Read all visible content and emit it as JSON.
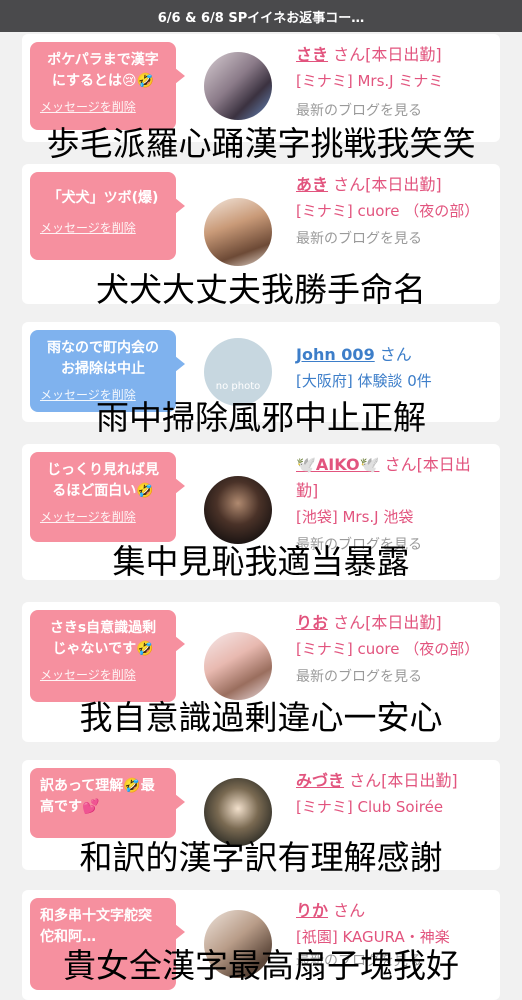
{
  "header": {
    "title": "6/6 & 6/8 SPイイネお返事コー…"
  },
  "cards": [
    {
      "bubble": "ポケパラまで漢字\nにするとは😢🤣",
      "delete_label": "メッセージを削除",
      "name": "さき",
      "suffix": "さん[本日出勤]",
      "shop": "[ミナミ] Mrs.J ミナミ",
      "blog": "最新のブログを見る",
      "overlay": "歩毛派羅心踊漢字挑戦我笑笑"
    },
    {
      "bubble": "「犬犬」ツボ(爆)",
      "delete_label": "メッセージを削除",
      "name": "あき",
      "suffix": "さん[本日出勤]",
      "shop": "[ミナミ] cuore （夜の部）",
      "blog": "最新のブログを見る",
      "overlay": "犬犬大丈夫我勝手命名"
    },
    {
      "bubble": "雨なので町内会の\nお掃除は中止",
      "delete_label": "メッセージを削除",
      "name": "John 009",
      "suffix": "さん",
      "shop": "[大阪府] 体験談 0件",
      "avatar_text": "no photo",
      "overlay": "雨中掃除風邪中止正解"
    },
    {
      "bubble": "じっくり見れば見\nるほど面白い🤣",
      "delete_label": "メッセージを削除",
      "name": "🕊️AIKO🕊️",
      "suffix": "さん[本日出勤]",
      "shop": "[池袋] Mrs.J 池袋",
      "blog": "最新のブログを見る",
      "overlay": "集中見恥我適当暴露"
    },
    {
      "bubble": "さきs自意識過剰\nじゃないです🤣",
      "delete_label": "メッセージを削除",
      "name": "りお",
      "suffix": "さん[本日出勤]",
      "shop": "[ミナミ] cuore （夜の部）",
      "blog": "最新のブログを見る",
      "overlay": "我自意識過剰違心一安心"
    },
    {
      "bubble": "訳あって理解🤣最\n高です💕",
      "delete_label": "メッセージを削除",
      "name": "みづき",
      "suffix": "さん[本日出勤]",
      "shop": "[ミナミ] Club Soirée",
      "blog": "最新のブログを見る",
      "overlay": "和訳的漢字訳有理解感謝"
    },
    {
      "bubble": "和多串十文字舵突\n佗和阿…",
      "delete_label": "メッセージを削除",
      "name": "りか",
      "suffix": "さん",
      "shop": "[祇園] KAGURA・神楽",
      "blog": "最新のブログを見る",
      "overlay": "貴女全漢字最高扇子塊我好"
    }
  ],
  "colors": {
    "accent_pink": "#e2547e",
    "bubble_pink": "#f6909f",
    "bubble_blue": "#7fb2ee",
    "link_blue": "#3d7ec9"
  }
}
